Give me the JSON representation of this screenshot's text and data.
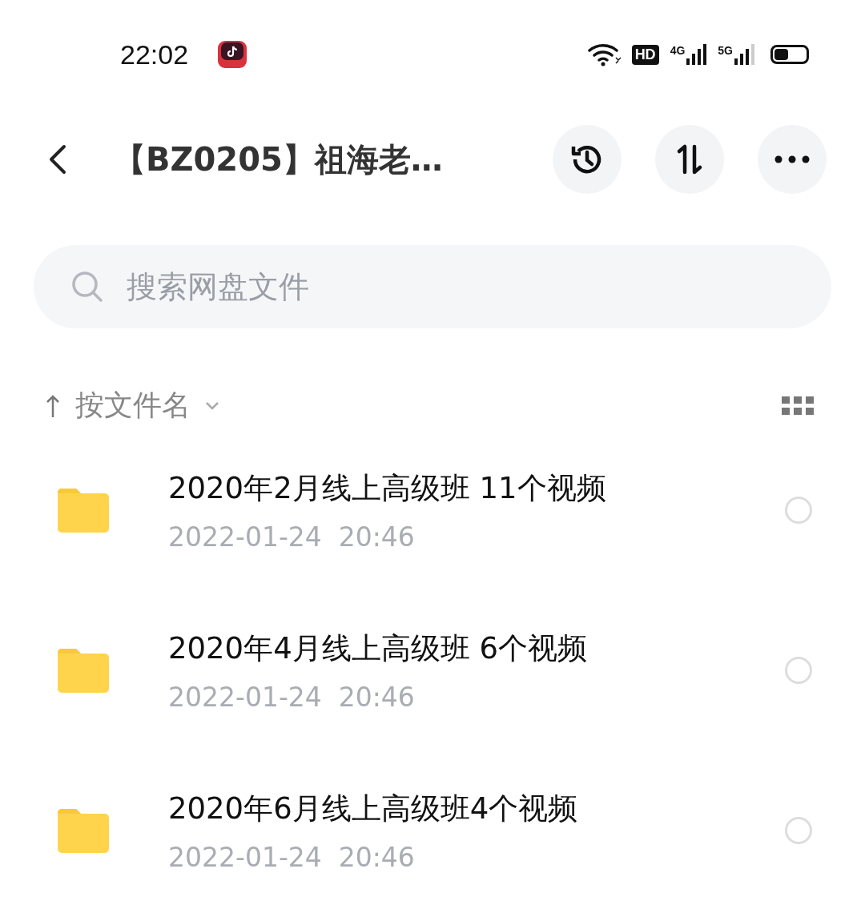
{
  "status_bar": {
    "time": "22:02",
    "hd_label": "HD",
    "networks": [
      "4G",
      "5G"
    ]
  },
  "header": {
    "title": "【BZ0205】祖海老…"
  },
  "search": {
    "placeholder": "搜索网盘文件"
  },
  "sort": {
    "label": "按文件名"
  },
  "files": [
    {
      "name": "2020年2月线上高级班 11个视频",
      "date": "2022-01-24  20:46",
      "checked": false
    },
    {
      "name": "2020年4月线上高级班 6个视频",
      "date": "2022-01-24  20:46",
      "checked": false
    },
    {
      "name": "2020年6月线上高级班4个视频",
      "date": "2022-01-24  20:46",
      "checked": false
    }
  ]
}
